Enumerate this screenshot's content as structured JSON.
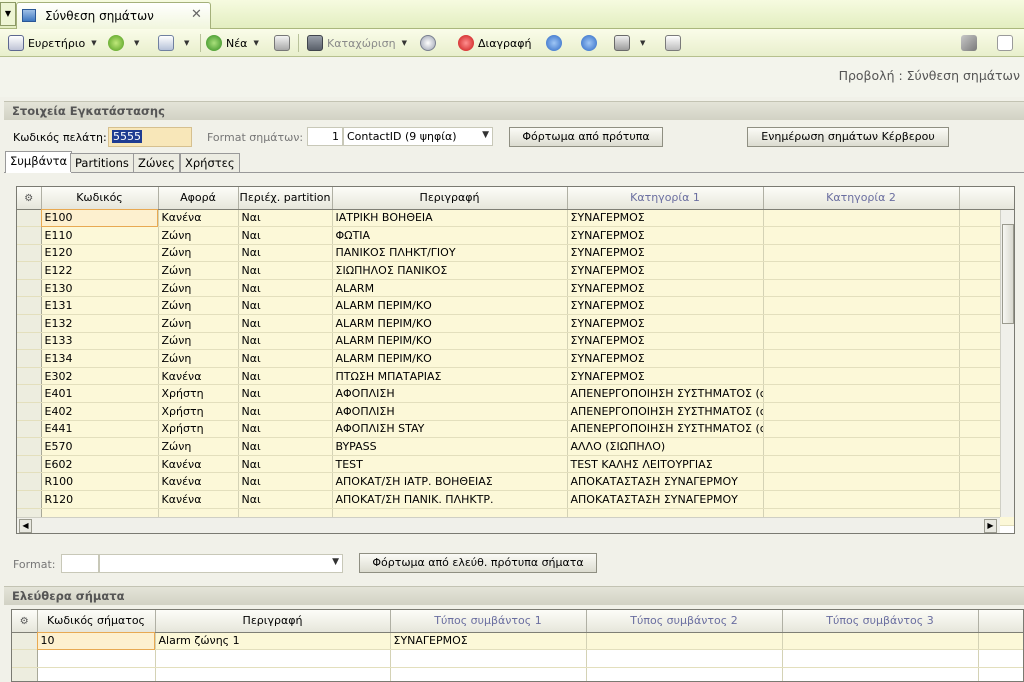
{
  "tab": {
    "title": "Σύνθεση σημάτων"
  },
  "toolbar": {
    "index_label": "Ευρετήριο",
    "new_label": "Νέα",
    "save_label": "Καταχώριση",
    "delete_label": "Διαγραφή"
  },
  "breadcrumb": {
    "label": "Προβολή : Σύνθεση σημάτων"
  },
  "installation": {
    "section_title": "Στοιχεία Εγκατάστασης",
    "customer_code_label": "Κωδικός πελάτη:",
    "customer_code_value": "5555",
    "format_label": "Format σημάτων:",
    "format_number": "1",
    "format_value": "ContactID (9 ψηφία)",
    "load_template_button": "Φόρτωμα από πρότυπα",
    "update_kerveros_button": "Ενημέρωση σημάτων Κέρβερου"
  },
  "page_tabs": [
    {
      "label": "Συμβάντα",
      "active": true
    },
    {
      "label": "Partitions",
      "active": false
    },
    {
      "label": "Ζώνες",
      "active": false
    },
    {
      "label": "Χρήστες",
      "active": false
    }
  ],
  "events_grid": {
    "columns": [
      "Κωδικός",
      "Αφορά",
      "Περιέχ. partition",
      "Περιγραφή",
      "Κατηγορία 1",
      "Κατηγορία 2"
    ],
    "rows": [
      [
        "E100",
        "Κανένα",
        "Ναι",
        "ΙΑΤΡΙΚΗ ΒΟΗΘΕΙΑ",
        "ΣΥΝΑΓΕΡΜΟΣ"
      ],
      [
        "E110",
        "Ζώνη",
        "Ναι",
        "ΦΩΤΙΑ",
        "ΣΥΝΑΓΕΡΜΟΣ"
      ],
      [
        "E120",
        "Ζώνη",
        "Ναι",
        "ΠΑΝΙΚΟΣ ΠΛΗΚΤ/ΓΙΟΥ",
        "ΣΥΝΑΓΕΡΜΟΣ"
      ],
      [
        "E122",
        "Ζώνη",
        "Ναι",
        "ΣΙΩΠΗΛΟΣ ΠΑΝΙΚΟΣ",
        "ΣΥΝΑΓΕΡΜΟΣ"
      ],
      [
        "E130",
        "Ζώνη",
        "Ναι",
        "ALARM",
        "ΣΥΝΑΓΕΡΜΟΣ"
      ],
      [
        "E131",
        "Ζώνη",
        "Ναι",
        "ALARM ΠΕΡΙΜ/ΚΟ",
        "ΣΥΝΑΓΕΡΜΟΣ"
      ],
      [
        "E132",
        "Ζώνη",
        "Ναι",
        "ALARM ΠΕΡΙΜ/ΚΟ",
        "ΣΥΝΑΓΕΡΜΟΣ"
      ],
      [
        "E133",
        "Ζώνη",
        "Ναι",
        "ALARM ΠΕΡΙΜ/ΚΟ",
        "ΣΥΝΑΓΕΡΜΟΣ"
      ],
      [
        "E134",
        "Ζώνη",
        "Ναι",
        "ALARM ΠΕΡΙΜ/ΚΟ",
        "ΣΥΝΑΓΕΡΜΟΣ"
      ],
      [
        "E302",
        "Κανένα",
        "Ναι",
        "ΠΤΩΣΗ ΜΠΑΤΑΡΙΑΣ",
        "ΣΥΝΑΓΕΡΜΟΣ"
      ],
      [
        "E401",
        "Χρήστη",
        "Ναι",
        "ΑΦΟΠΛΙΣΗ",
        "ΑΠΕΝΕΡΓΟΠΟΙΗΣΗ ΣΥΣΤΗΜΑΤΟΣ (c"
      ],
      [
        "E402",
        "Χρήστη",
        "Ναι",
        "ΑΦΟΠΛΙΣΗ",
        "ΑΠΕΝΕΡΓΟΠΟΙΗΣΗ ΣΥΣΤΗΜΑΤΟΣ (c"
      ],
      [
        "E441",
        "Χρήστη",
        "Ναι",
        "ΑΦΟΠΛΙΣΗ STAY",
        "ΑΠΕΝΕΡΓΟΠΟΙΗΣΗ ΣΥΣΤΗΜΑΤΟΣ (c"
      ],
      [
        "E570",
        "Ζώνη",
        "Ναι",
        "BYPASS",
        "ΑΛΛΟ (ΣΙΩΠΗΛΟ)"
      ],
      [
        "E602",
        "Κανένα",
        "Ναι",
        "TEST",
        "TEST ΚΑΛΗΣ ΛΕΙΤΟΥΡΓΙΑΣ"
      ],
      [
        "R100",
        "Κανένα",
        "Ναι",
        "ΑΠΟΚΑΤ/ΣΗ ΙΑΤΡ. ΒΟΗΘΕΙΑΣ",
        "ΑΠΟΚΑΤΑΣΤΑΣΗ ΣΥΝΑΓΕΡΜΟΥ"
      ],
      [
        "R120",
        "Κανένα",
        "Ναι",
        "ΑΠΟΚΑΤ/ΣΗ ΠΑΝΙΚ. ΠΛΗΚΤΡ.",
        "ΑΠΟΚΑΤΑΣΤΑΣΗ ΣΥΝΑΓΕΡΜΟΥ"
      ]
    ]
  },
  "format_row": {
    "label": "Format:",
    "load_free_button": "Φόρτωμα από ελεύθ. πρότυπα σήματα"
  },
  "free_signals": {
    "section_title": "Ελεύθερα σήματα",
    "columns": [
      "Κωδικός σήματος",
      "Περιγραφή",
      "Τύπος συμβάντος 1",
      "Τύπος συμβάντος 2",
      "Τύπος συμβάντος 3"
    ],
    "rows": [
      [
        "10",
        "Alarm ζώνης 1",
        "ΣΥΝΑΓΕΡΜΟΣ",
        "",
        ""
      ]
    ]
  },
  "colors": {
    "accent": "#e8a952",
    "grid_row": "#fcf8d8",
    "toolbar": "#e8efcc"
  }
}
